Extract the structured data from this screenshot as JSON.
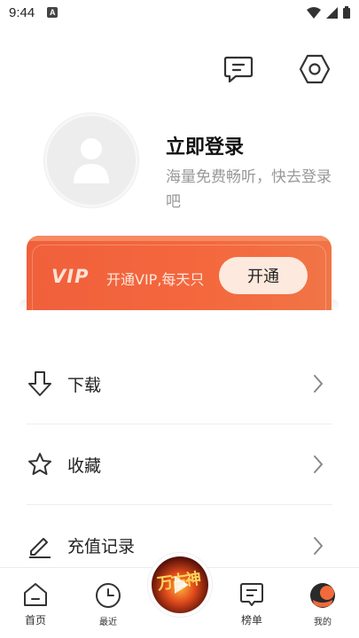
{
  "status_bar": {
    "time": "9:44",
    "notification_letter": "A"
  },
  "header": {
    "icons": [
      "message-icon",
      "settings-hexagon-icon"
    ]
  },
  "profile": {
    "title": "立即登录",
    "subtitle": "海量免费畅听，快去登录吧"
  },
  "vip": {
    "logo": "VIP",
    "text": "开通VIP,每天只",
    "button_label": "开通",
    "accent": "#f4683e"
  },
  "menu": {
    "items": [
      {
        "label": "下载",
        "icon": "download-icon"
      },
      {
        "label": "收藏",
        "icon": "star-icon"
      },
      {
        "label": "充值记录",
        "icon": "pencil-icon"
      }
    ]
  },
  "tabbar": {
    "tabs": [
      {
        "label": "首页",
        "icon": "home-icon"
      },
      {
        "label": "最近",
        "icon": "clock-icon"
      },
      {
        "label": "榜单",
        "icon": "chart-list-icon"
      },
      {
        "label": "我的",
        "icon": "profile-face-icon"
      }
    ],
    "center": {
      "title": "万古神",
      "icon": "play-icon"
    }
  }
}
